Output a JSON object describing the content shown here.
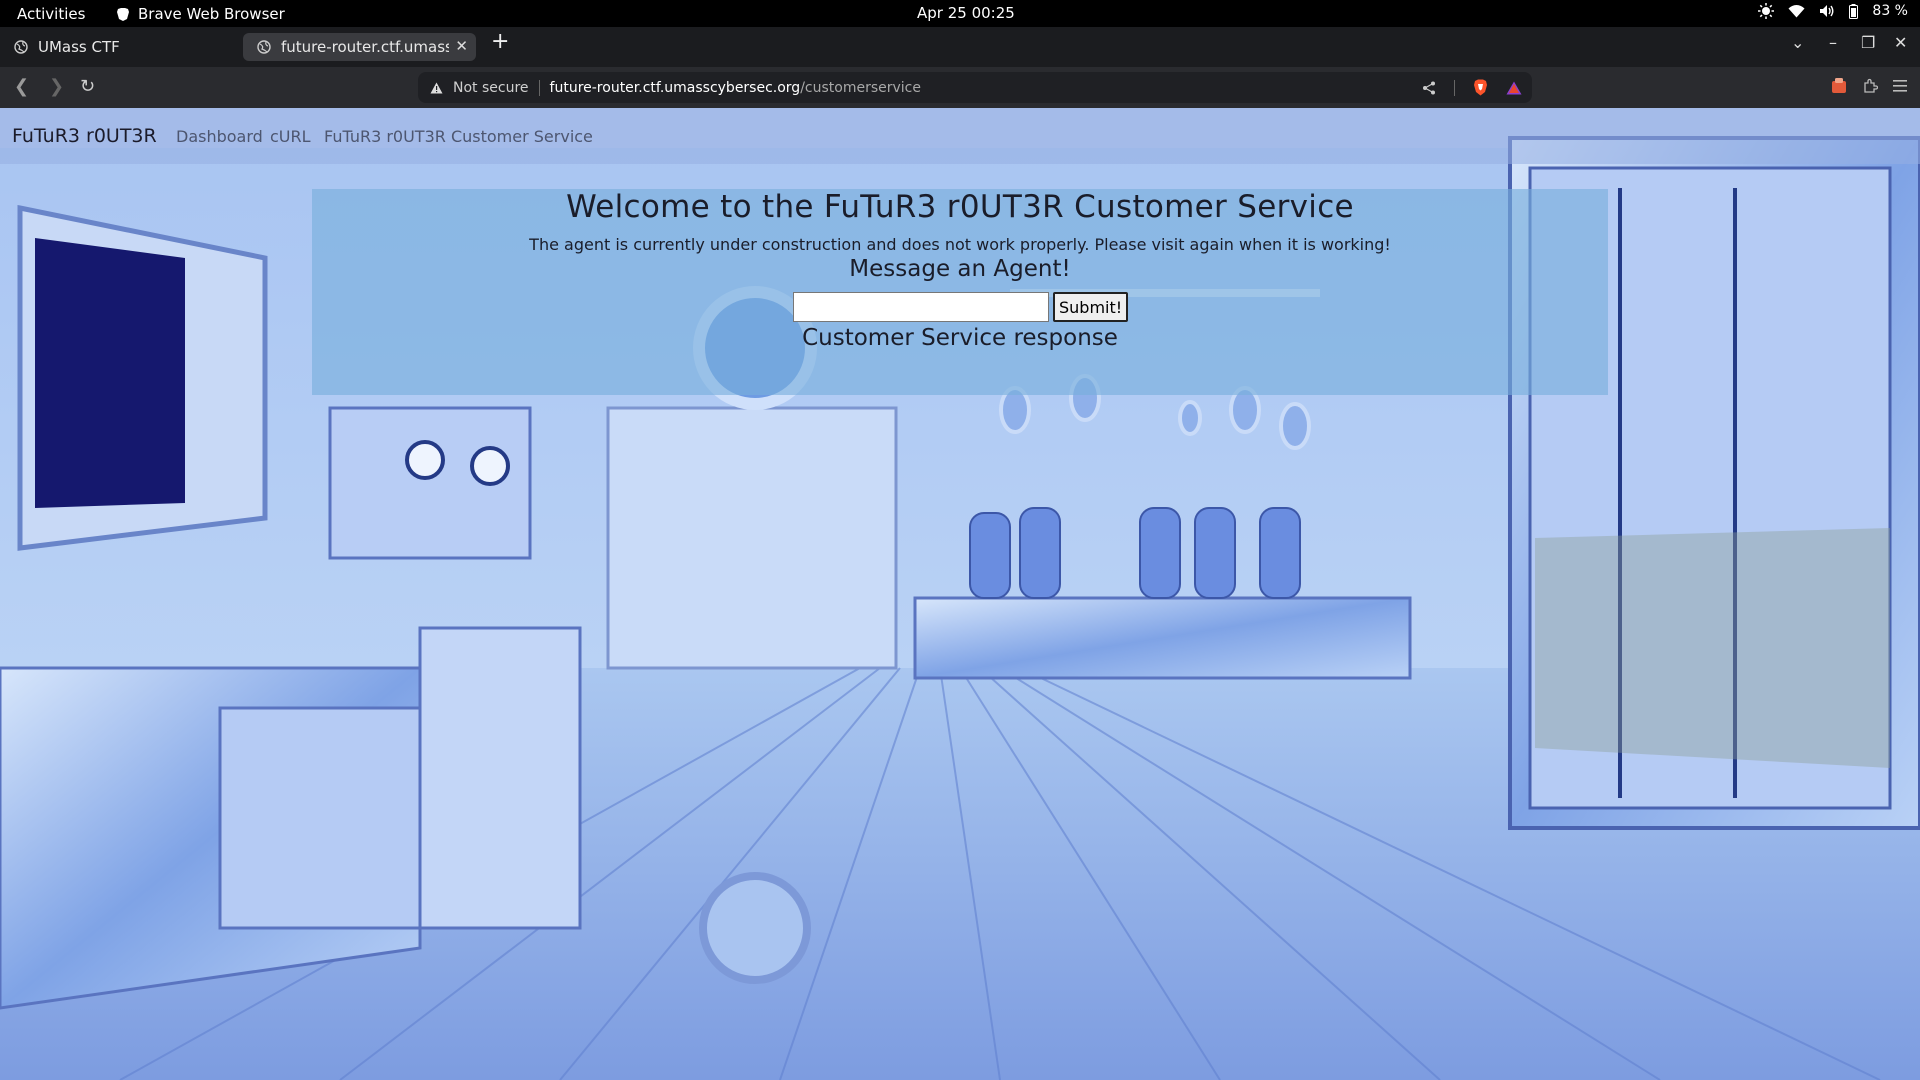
{
  "os": {
    "activities_label": "Activities",
    "app_name": "Brave Web Browser",
    "clock": "Apr 25  00:25",
    "battery": "83 %"
  },
  "browser": {
    "tabs": [
      {
        "title": "UMass CTF"
      },
      {
        "title": "future-router.ctf.umasscybersec.org/customerservice"
      }
    ],
    "new_tab_label": "+",
    "security_label": "Not secure",
    "url_host": "future-router.ctf.umasscybersec.org",
    "url_path": "/customerservice"
  },
  "site": {
    "brand": "FuTuR3 r0UT3R",
    "nav": [
      {
        "label": "Dashboard"
      },
      {
        "label": "cURL"
      },
      {
        "label": "FuTuR3 r0UT3R Customer Service"
      }
    ],
    "title": "Welcome to the FuTuR3 r0UT3R Customer Service",
    "notice": "The agent is currently under construction and does not work properly. Please visit again when it is working!",
    "message_heading": "Message an Agent!",
    "message_input": {
      "value": "",
      "placeholder": ""
    },
    "submit_label": "Submit!",
    "response_heading": "Customer Service response"
  },
  "colors": {
    "panel_bg": "#78afdc",
    "page_bg": "#9ab6ec"
  }
}
